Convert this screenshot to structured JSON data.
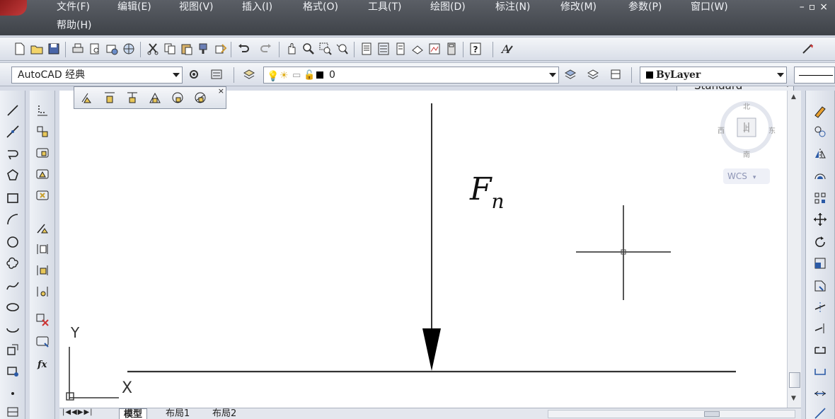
{
  "menubar": {
    "items": [
      "文件(F)",
      "编辑(E)",
      "视图(V)",
      "插入(I)",
      "格式(O)",
      "工具(T)",
      "绘图(D)",
      "标注(N)",
      "修改(M)",
      "参数(P)",
      "窗口(W)",
      "帮助(H)"
    ],
    "window_controls": "–▫×"
  },
  "standard_toolbar": {
    "text_style": "Standard",
    "icons": [
      "new-icon",
      "open-icon",
      "save-icon",
      "print-icon",
      "print-preview-icon",
      "publish-icon",
      "3d-print-icon",
      "cut-icon",
      "copy-icon",
      "paste-icon",
      "match-properties-icon",
      "block-editor-icon",
      "undo-icon",
      "redo-icon",
      "pan-icon",
      "zoom-realtime-icon",
      "zoom-window-icon",
      "zoom-previous-icon",
      "properties-icon",
      "design-center-icon",
      "tool-palettes-icon",
      "sheet-set-icon",
      "markup-icon",
      "quickcalc-icon",
      "help-icon"
    ]
  },
  "workspace_toolbar": {
    "workspace": "AutoCAD 经典",
    "layer": "0",
    "color": "ByLayer"
  },
  "drawing": {
    "force_label_main": "F",
    "force_label_sub": "n"
  },
  "viewcube": {
    "north": "北",
    "south": "南",
    "east": "东",
    "west": "西",
    "top_face": "上",
    "wcs": "WCS"
  },
  "ucs": {
    "x_label": "X",
    "y_label": "Y"
  },
  "tabs": [
    "模型",
    "布局1",
    "布局2"
  ],
  "colors": {
    "menubar": "#4a4e55",
    "canvas": "#ffffff",
    "accent": "#2b5aa6"
  }
}
